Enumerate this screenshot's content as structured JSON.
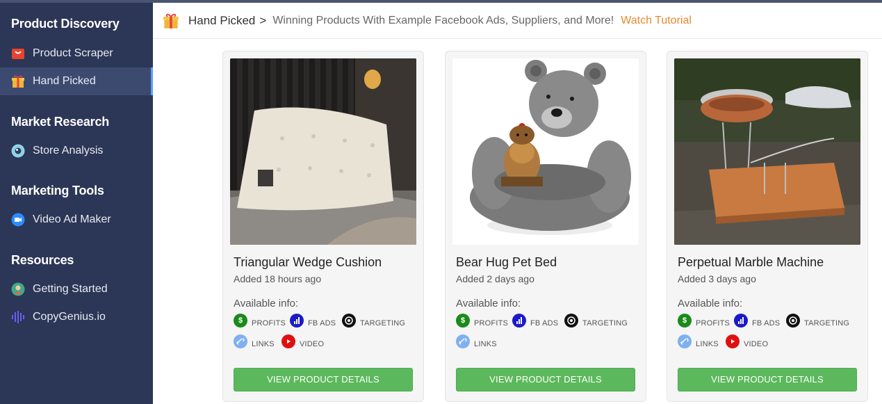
{
  "sidebar": {
    "sections": [
      {
        "title": "Product Discovery",
        "items": [
          {
            "label": "Product Scraper",
            "icon": "shopping-bag-icon"
          },
          {
            "label": "Hand Picked",
            "icon": "gift-icon",
            "active": true
          }
        ]
      },
      {
        "title": "Market Research",
        "items": [
          {
            "label": "Store Analysis",
            "icon": "eye-icon"
          }
        ]
      },
      {
        "title": "Marketing Tools",
        "items": [
          {
            "label": "Video Ad Maker",
            "icon": "video-camera-icon"
          }
        ]
      },
      {
        "title": "Resources",
        "items": [
          {
            "label": "Getting Started",
            "icon": "person-icon"
          },
          {
            "label": "CopyGenius.io",
            "icon": "soundwave-icon"
          }
        ]
      }
    ]
  },
  "header": {
    "breadcrumb": "Hand Picked",
    "separator": ">",
    "subtitle": "Winning Products With Example Facebook Ads, Suppliers, and More!",
    "tutorial_link": "Watch Tutorial",
    "accent_color": "#e58a2e"
  },
  "info_labels": {
    "profits": "PROFITS",
    "fb_ads": "FB ADS",
    "targeting": "TARGETING",
    "links": "LINKS",
    "video": "VIDEO"
  },
  "products": [
    {
      "title": "Triangular Wedge Cushion",
      "added": "Added 18 hours ago",
      "available_label": "Available info:",
      "button": "VIEW PRODUCT DETAILS"
    },
    {
      "title": "Bear Hug Pet Bed",
      "added": "Added 2 days ago",
      "available_label": "Available info:",
      "button": "VIEW PRODUCT DETAILS"
    },
    {
      "title": "Perpetual Marble Machine",
      "added": "Added 3 days ago",
      "available_label": "Available info:",
      "button": "VIEW PRODUCT DETAILS"
    }
  ],
  "colors": {
    "sidebar_bg": "#2c3656",
    "button_green": "#5cb85c",
    "profits_icon": "#1a8a1a",
    "fb_ads_icon": "#1a1acc",
    "targeting_icon": "#111111",
    "links_icon": "#7fb0f0",
    "video_icon": "#e01010"
  }
}
